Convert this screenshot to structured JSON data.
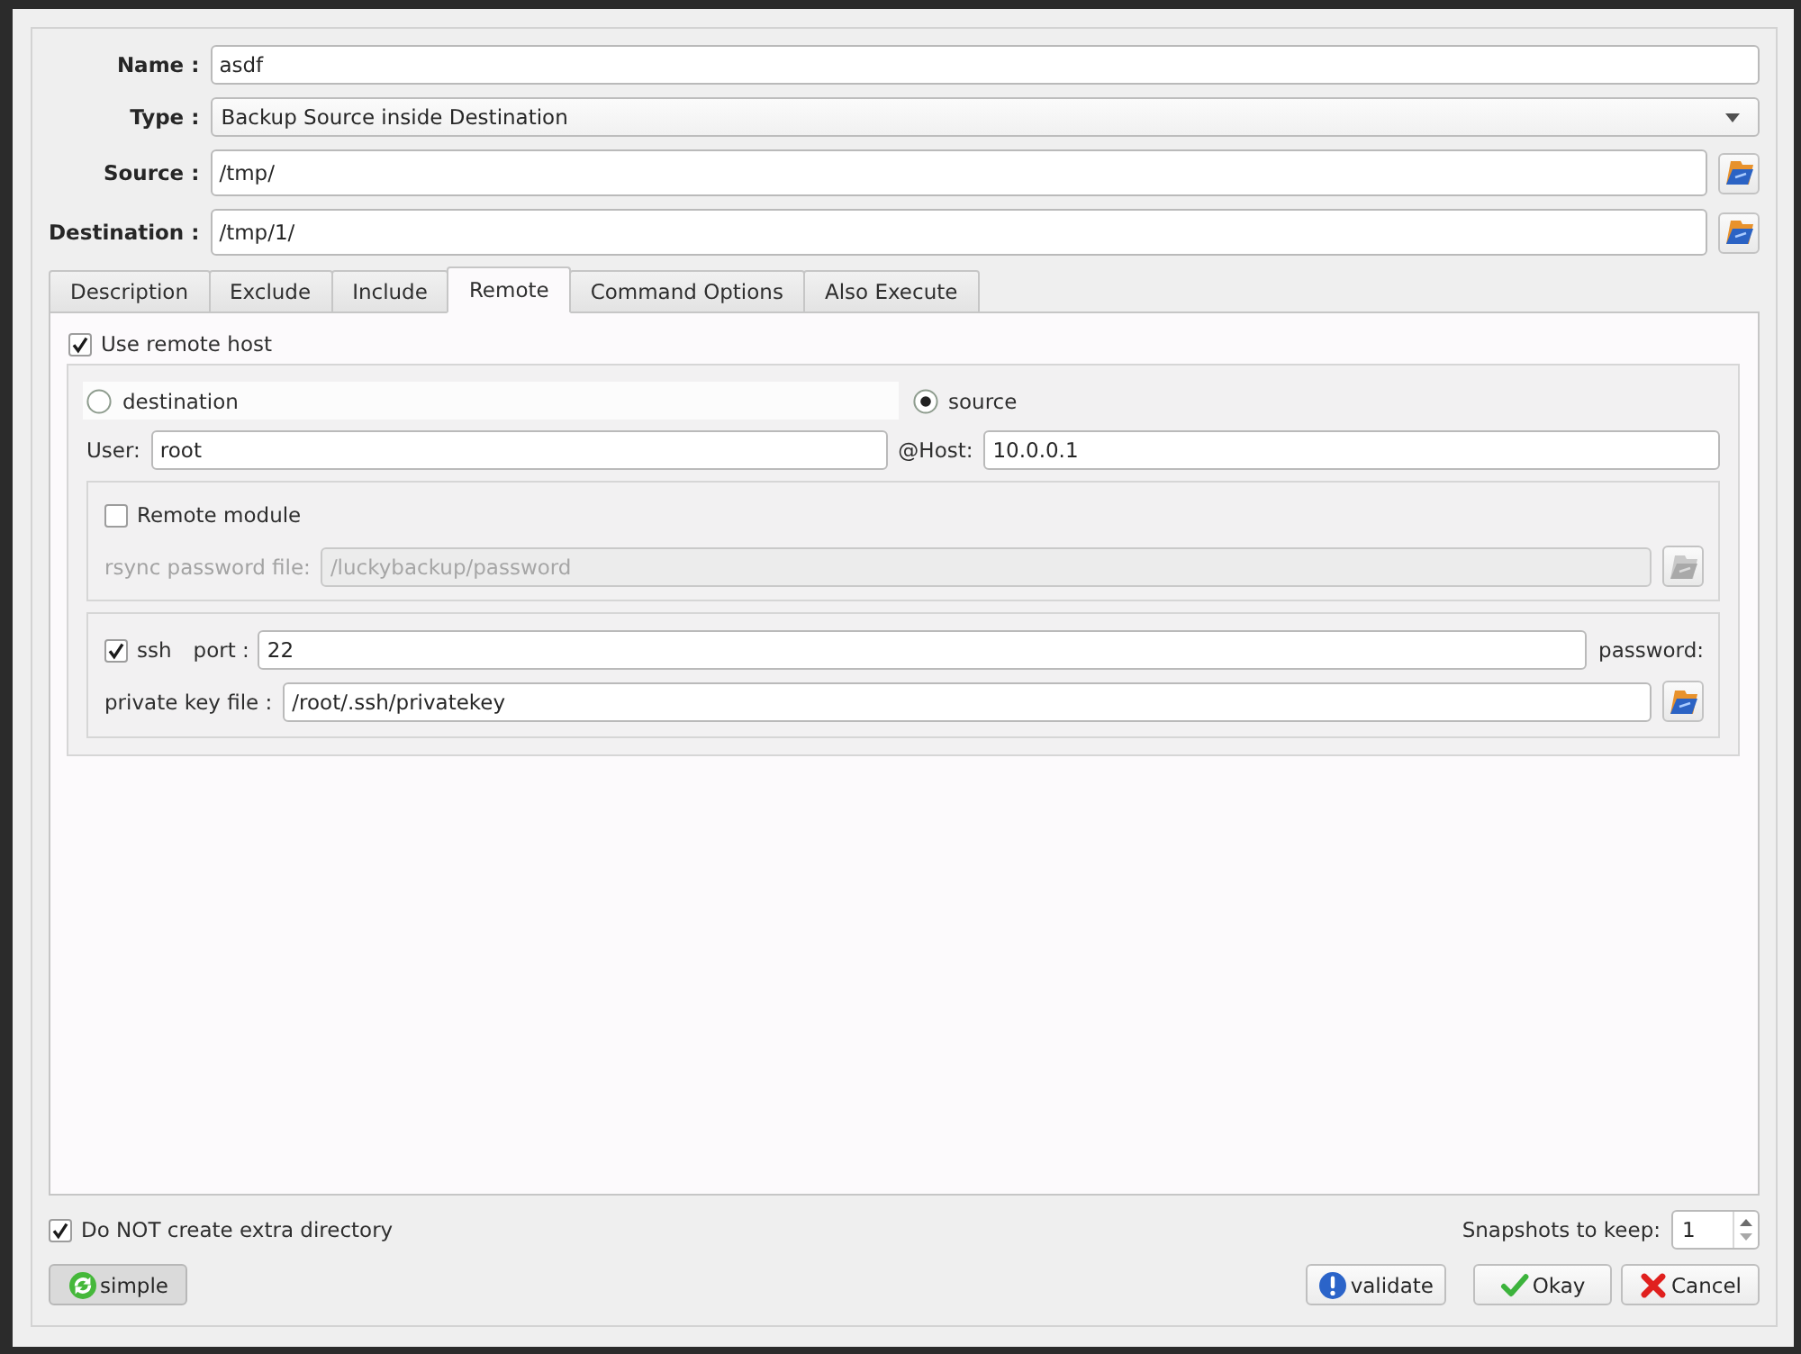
{
  "form": [
    {
      "kind": "text",
      "label": "Name :",
      "value": "asdf"
    },
    {
      "kind": "combo",
      "label": "Type :",
      "value": "Backup Source inside Destination"
    },
    {
      "kind": "path",
      "label": "Source :",
      "value": "/tmp/"
    },
    {
      "kind": "path",
      "label": "Destination :",
      "value": "/tmp/1/"
    }
  ],
  "tabs": [
    {
      "label": "Description",
      "selected": false
    },
    {
      "label": "Exclude",
      "selected": false
    },
    {
      "label": "Include",
      "selected": false
    },
    {
      "label": "Remote",
      "selected": true
    },
    {
      "label": "Command Options",
      "selected": false
    },
    {
      "label": "Also Execute",
      "selected": false
    }
  ],
  "remote": {
    "use_remote_host": {
      "label": "Use remote host",
      "checked": true
    },
    "target": [
      {
        "label": "destination",
        "selected": false,
        "highlighted": true
      },
      {
        "label": "source",
        "selected": true,
        "highlighted": false
      }
    ],
    "user": {
      "label": "User:",
      "value": "root"
    },
    "host": {
      "label": "@Host:",
      "value": "10.0.0.1"
    },
    "remote_module": {
      "label": "Remote module",
      "checked": false
    },
    "rsync_password_file": {
      "label": "rsync password file:",
      "value": "/luckybackup/password",
      "disabled": true
    },
    "ssh": {
      "label": "ssh",
      "checked": true
    },
    "port": {
      "label": "port :",
      "value": "22"
    },
    "password": {
      "label": "password:"
    },
    "private_key_file": {
      "label": "private key file :",
      "value": "/root/.ssh/privatekey"
    }
  },
  "no_extra_directory": {
    "label": "Do NOT create extra directory",
    "checked": true
  },
  "snapshots": {
    "label": "Snapshots to keep:",
    "value": "1"
  },
  "buttons": [
    {
      "kind": "simple",
      "label": "simple",
      "pressed": true
    },
    {
      "kind": "validate",
      "label": "validate",
      "pressed": false
    },
    {
      "kind": "okay",
      "label": "Okay",
      "pressed": false
    },
    {
      "kind": "cancel",
      "label": "Cancel",
      "pressed": false
    }
  ]
}
